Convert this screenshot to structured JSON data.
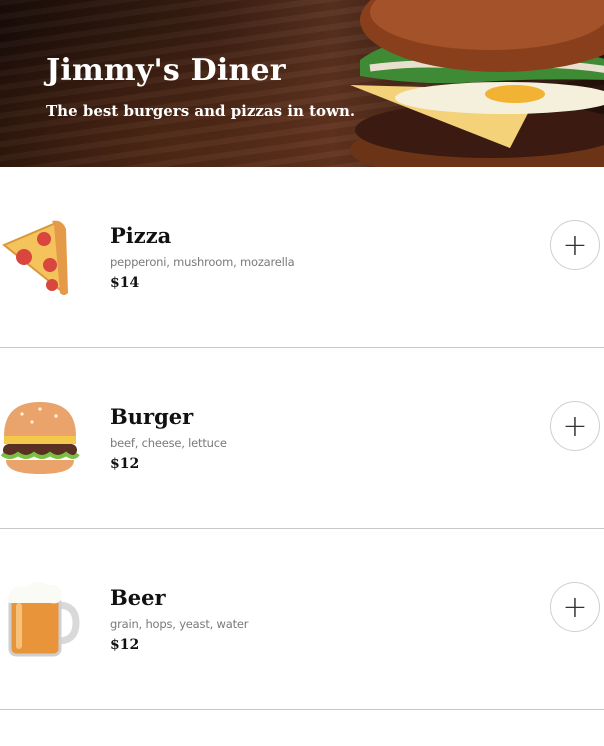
{
  "header": {
    "title": "Jimmy's Diner",
    "subtitle": "The best burgers and pizzas in town."
  },
  "menu": {
    "items": [
      {
        "name": "Pizza",
        "ingredients": "pepperoni, mushroom, mozarella",
        "price": "$14",
        "icon": "pizza-icon",
        "add_label": "+"
      },
      {
        "name": "Burger",
        "ingredients": "beef, cheese, lettuce",
        "price": "$12",
        "icon": "burger-icon",
        "add_label": "+"
      },
      {
        "name": "Beer",
        "ingredients": "grain, hops, yeast, water",
        "price": "$12",
        "icon": "beer-icon",
        "add_label": "+"
      }
    ]
  },
  "colors": {
    "text": "#111111",
    "muted": "#7a7a7a",
    "divider": "#c8c8c8",
    "hero_bg": "#3a1e12"
  }
}
